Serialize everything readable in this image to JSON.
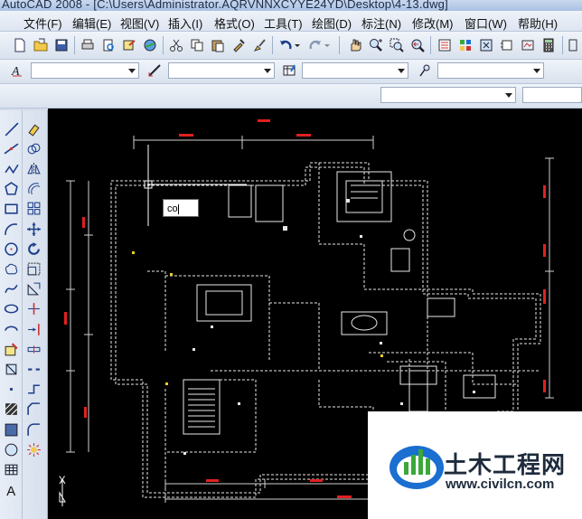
{
  "window": {
    "title": "AutoCAD 2008 - [C:\\Users\\Administrator.AQRVNNXCYYE24YD\\Desktop\\4-13.dwg]"
  },
  "menu": [
    {
      "label": "文件(F)"
    },
    {
      "label": "编辑(E)"
    },
    {
      "label": "视图(V)"
    },
    {
      "label": "插入(I)"
    },
    {
      "label": "格式(O)"
    },
    {
      "label": "工具(T)"
    },
    {
      "label": "绘图(D)"
    },
    {
      "label": "标注(N)"
    },
    {
      "label": "修改(M)"
    },
    {
      "label": "窗口(W)"
    },
    {
      "label": "帮助(H)"
    }
  ],
  "standard_toolbar_icons": [
    "new-icon",
    "open-icon",
    "save-icon",
    "print-icon",
    "plot-preview-icon",
    "publish-icon",
    "3d-dwf-icon",
    "cut-icon",
    "copy-icon",
    "paste-icon",
    "match-properties-icon",
    "brush-icon",
    "undo-icon",
    "redo-icon",
    "pan-icon",
    "zoom-realtime-icon",
    "zoom-window-icon",
    "zoom-previous-icon",
    "properties-icon",
    "design-center-icon",
    "tool-palettes-icon",
    "sheet-set-icon",
    "markup-icon",
    "calculator-icon"
  ],
  "properties_toolbar": {
    "text_style": "",
    "dim_style": "",
    "table_style": "",
    "mleader_style": "",
    "layer": "",
    "color": ""
  },
  "draw_tools": [
    "line-icon",
    "construction-line-icon",
    "polyline-icon",
    "polygon-icon",
    "rectangle-icon",
    "arc-icon",
    "circle-icon",
    "revision-cloud-icon",
    "spline-icon",
    "ellipse-icon",
    "ellipse-arc-icon",
    "insert-block-icon",
    "make-block-icon",
    "point-icon",
    "hatch-icon",
    "gradient-icon",
    "region-icon",
    "table-icon",
    "multiline-text-icon"
  ],
  "modify_tools": [
    "erase-icon",
    "copy-object-icon",
    "mirror-icon",
    "offset-icon",
    "array-icon",
    "move-icon",
    "rotate-icon",
    "scale-icon",
    "stretch-icon",
    "trim-icon",
    "extend-icon",
    "break-at-point-icon",
    "break-icon",
    "join-icon",
    "chamfer-icon",
    "fillet-icon",
    "explode-icon"
  ],
  "command": {
    "input": "co"
  },
  "ucs": {
    "y_label": "Y"
  },
  "watermark": {
    "title": "土木工程网",
    "url": "www.civilcn.com"
  },
  "colors": {
    "canvas": "#000000",
    "dimension": "#e02020",
    "linework": "#e8e8e8",
    "accent_blue": "#1a6fd1",
    "accent_green": "#3aa83a"
  }
}
